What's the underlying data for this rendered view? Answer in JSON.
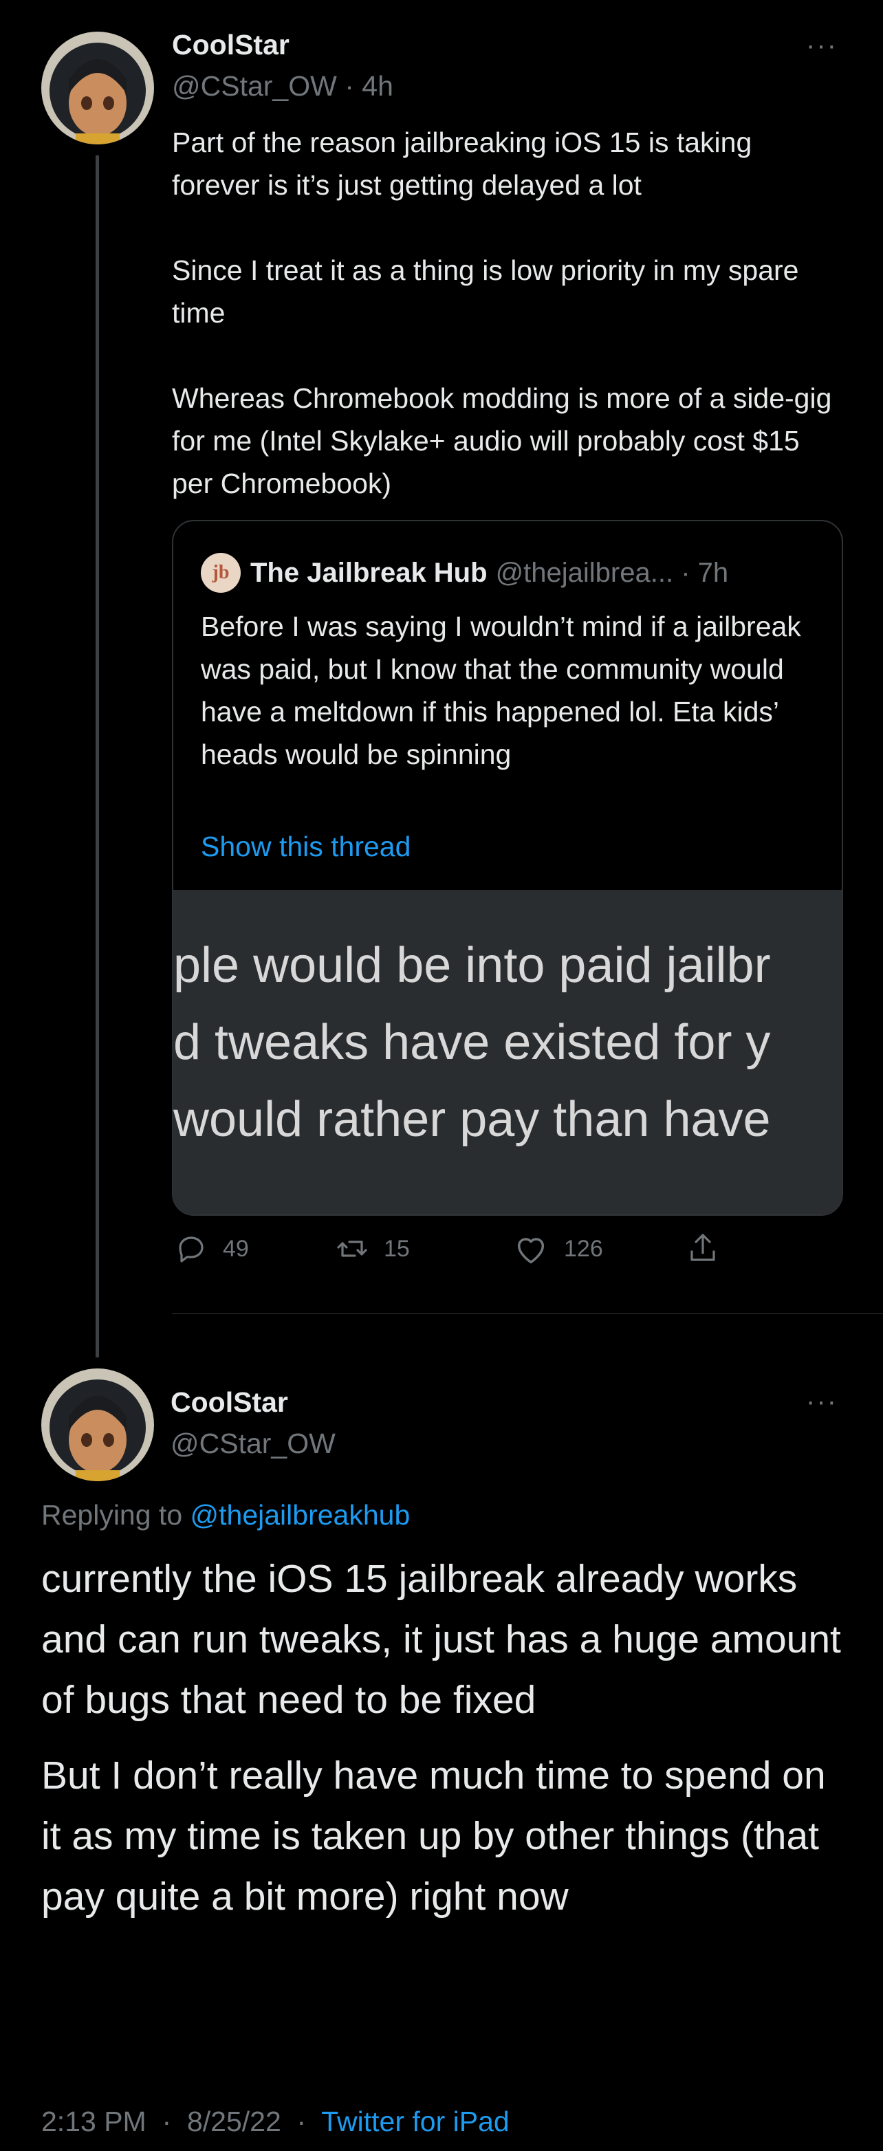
{
  "tweet1": {
    "author_name": "CoolStar",
    "author_handle": "@CStar_OW",
    "time": "4h",
    "more": "···",
    "paragraphs": [
      "Part of the reason jailbreaking iOS 15 is taking forever is it’s just getting delayed a lot",
      "Since I treat it as a thing is low priority in my spare time",
      "Whereas Chromebook modding is more of a side-gig for me (Intel Skylake+ audio will probably cost $15 per Chromebook)"
    ],
    "quote": {
      "avatar_text": "jb",
      "name": "The Jailbreak Hub",
      "handle": "@thejailbrea...",
      "time": "7h",
      "text": "Before I was saying I wouldn’t mind if a jailbreak was paid, but I know that the community would have a meltdown if this happened lol. Eta kids’ heads would be spinning",
      "show_thread": "Show this thread",
      "media_lines": [
        "ple would be into paid jailbr",
        "d tweaks have existed for y",
        "would rather pay than have"
      ]
    },
    "actions": {
      "replies": "49",
      "retweets": "15",
      "likes": "126"
    }
  },
  "tweet2": {
    "author_name": "CoolStar",
    "author_handle": "@CStar_OW",
    "more": "···",
    "replying_prefix": "Replying to",
    "replying_handle": "@thejailbreakhub",
    "paragraphs": [
      "currently the iOS 15 jailbreak already works and can run tweaks, it just has a huge amount of bugs that need to be fixed",
      "But I don’t really have much time to spend on it as my time is taken up by other things (that pay quite a bit more) right now"
    ],
    "time": "2:13 PM",
    "date": "8/25/22",
    "source": "Twitter for iPad"
  },
  "colors": {
    "background": "#000000",
    "text": "#e7e9ea",
    "muted": "#71767b",
    "link": "#1d9bf0",
    "border": "#2f3336"
  }
}
